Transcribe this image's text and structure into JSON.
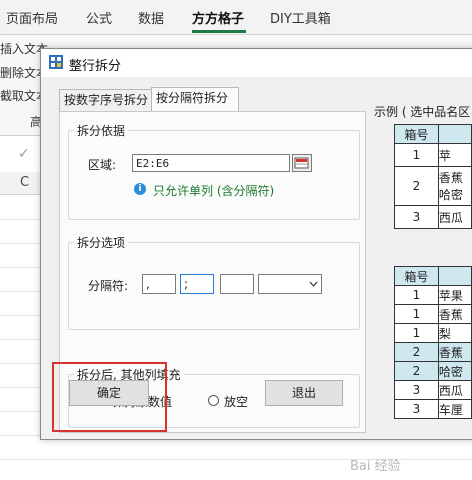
{
  "ribbon": {
    "tabs": [
      "页面布局",
      "公式",
      "数据",
      "方方格子",
      "DIY工具箱"
    ],
    "active_tab": "方方格子",
    "left_commands": [
      "插入文本",
      "删除文本",
      "截取文本"
    ],
    "partial_label": "高"
  },
  "sheet": {
    "column_label": "C"
  },
  "dialog": {
    "title": "整行拆分",
    "tabs": [
      "按数字序号拆分",
      "按分隔符拆分"
    ],
    "active_tab_index": 1,
    "basis_group": {
      "legend": "拆分依据",
      "area_label": "区域:",
      "area_value": "E2:E6",
      "hint": "只允许单列 (含分隔符)"
    },
    "options_group": {
      "legend": "拆分选项",
      "separator_label": "分隔符:",
      "separators": [
        ",",
        ";",
        ""
      ],
      "dropdown_value": ""
    },
    "fill_group": {
      "legend": "拆分后, 其他列填充",
      "options": [
        "保持原数值",
        "放空"
      ],
      "selected_index": 0
    },
    "ok_label": "确定",
    "exit_label": "退出",
    "example": {
      "title": "示例 ( 选中品名区",
      "table1": {
        "header": [
          "箱号",
          ""
        ],
        "rows": [
          [
            "1",
            "苹"
          ],
          [
            "2",
            "香蕉 哈密"
          ],
          [
            "3",
            "西瓜"
          ]
        ]
      },
      "table2": {
        "header": [
          "箱号",
          ""
        ],
        "rows": [
          [
            "1",
            "苹果"
          ],
          [
            "1",
            "香蕉"
          ],
          [
            "1",
            "梨"
          ],
          [
            "2",
            "香蕉"
          ],
          [
            "2",
            "哈密"
          ],
          [
            "3",
            "西瓜"
          ],
          [
            "3",
            "车厘"
          ]
        ]
      }
    }
  },
  "watermark": "Bai 经验"
}
